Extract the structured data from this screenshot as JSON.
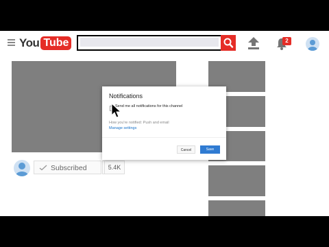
{
  "logo": {
    "you": "You",
    "tube": "Tube"
  },
  "search": {
    "placeholder": "",
    "value": ""
  },
  "notifications": {
    "badge_count": "2"
  },
  "channel": {
    "subscribe_label": "Subscribed",
    "subscriber_count": "5.4K"
  },
  "dialog": {
    "title": "Notifications",
    "option_label": "Send me all notifications for this channel",
    "how_notified": "How you're notified: Push and email",
    "manage_link": "Manage settings",
    "cancel_label": "Cancel",
    "save_label": "Save"
  },
  "colors": {
    "brand_red": "#e52d27",
    "link_blue": "#1a73c8",
    "save_blue": "#2f7bd2",
    "placeholder_gray": "#7f7f7f"
  },
  "icons": [
    "menu-icon",
    "search-icon",
    "upload-icon",
    "bell-icon",
    "account-icon",
    "check-icon",
    "mouse-cursor-icon"
  ]
}
